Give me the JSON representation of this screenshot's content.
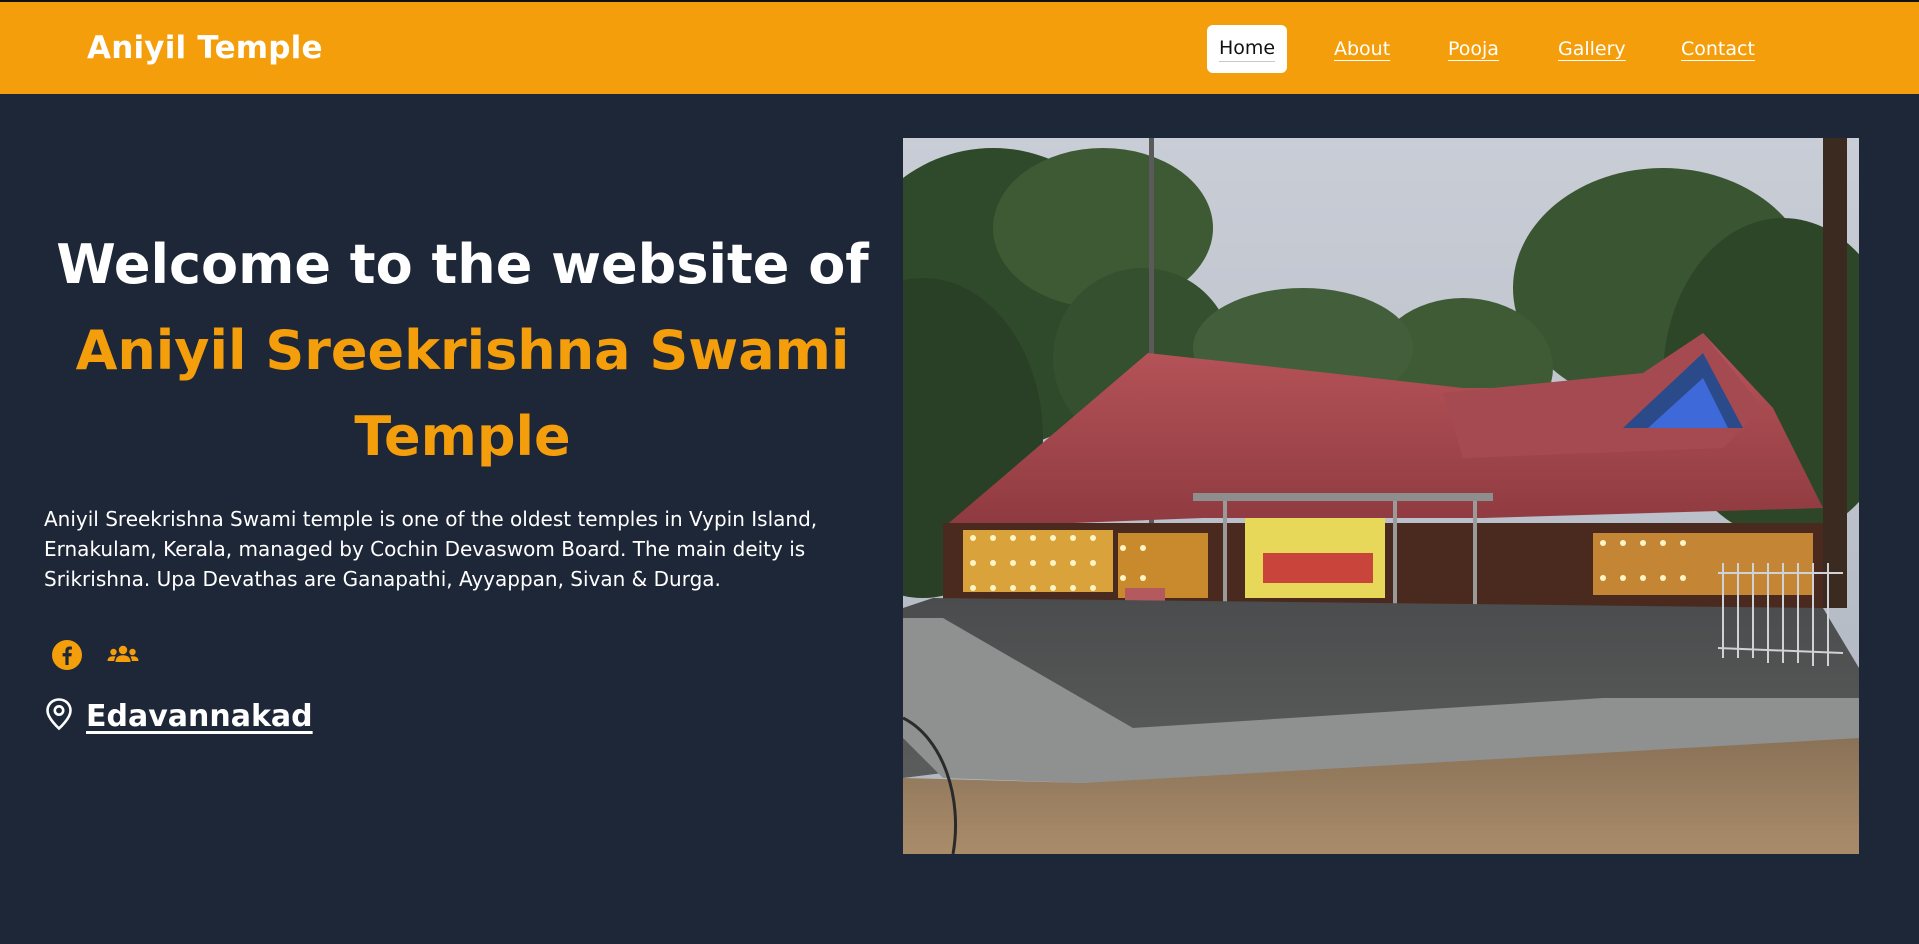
{
  "brand": "Aniyil Temple",
  "nav": {
    "home": "Home",
    "about": "About",
    "pooja": "Pooja",
    "gallery": "Gallery",
    "contact": "Contact"
  },
  "hero": {
    "welcome": "Welcome to the website of",
    "temple_line1": "Aniyil Sreekrishna Swami",
    "temple_line2": "Temple",
    "description": "Aniyil Sreekrishna Swami temple is one of the oldest temples in Vypin Island, Ernakulam, Kerala, managed by Cochin Devaswom Board. The main deity is Srikrishna. Upa Devathas are Ganapathi, Ayyappan, Sivan & Durga."
  },
  "social": {
    "icons": [
      "facebook-icon",
      "community-icon"
    ]
  },
  "location": {
    "icon": "map-pin-icon",
    "name": "Edavannakad"
  },
  "colors": {
    "accent": "#f49e0c",
    "background": "#1e2738",
    "text": "#ffffff"
  }
}
